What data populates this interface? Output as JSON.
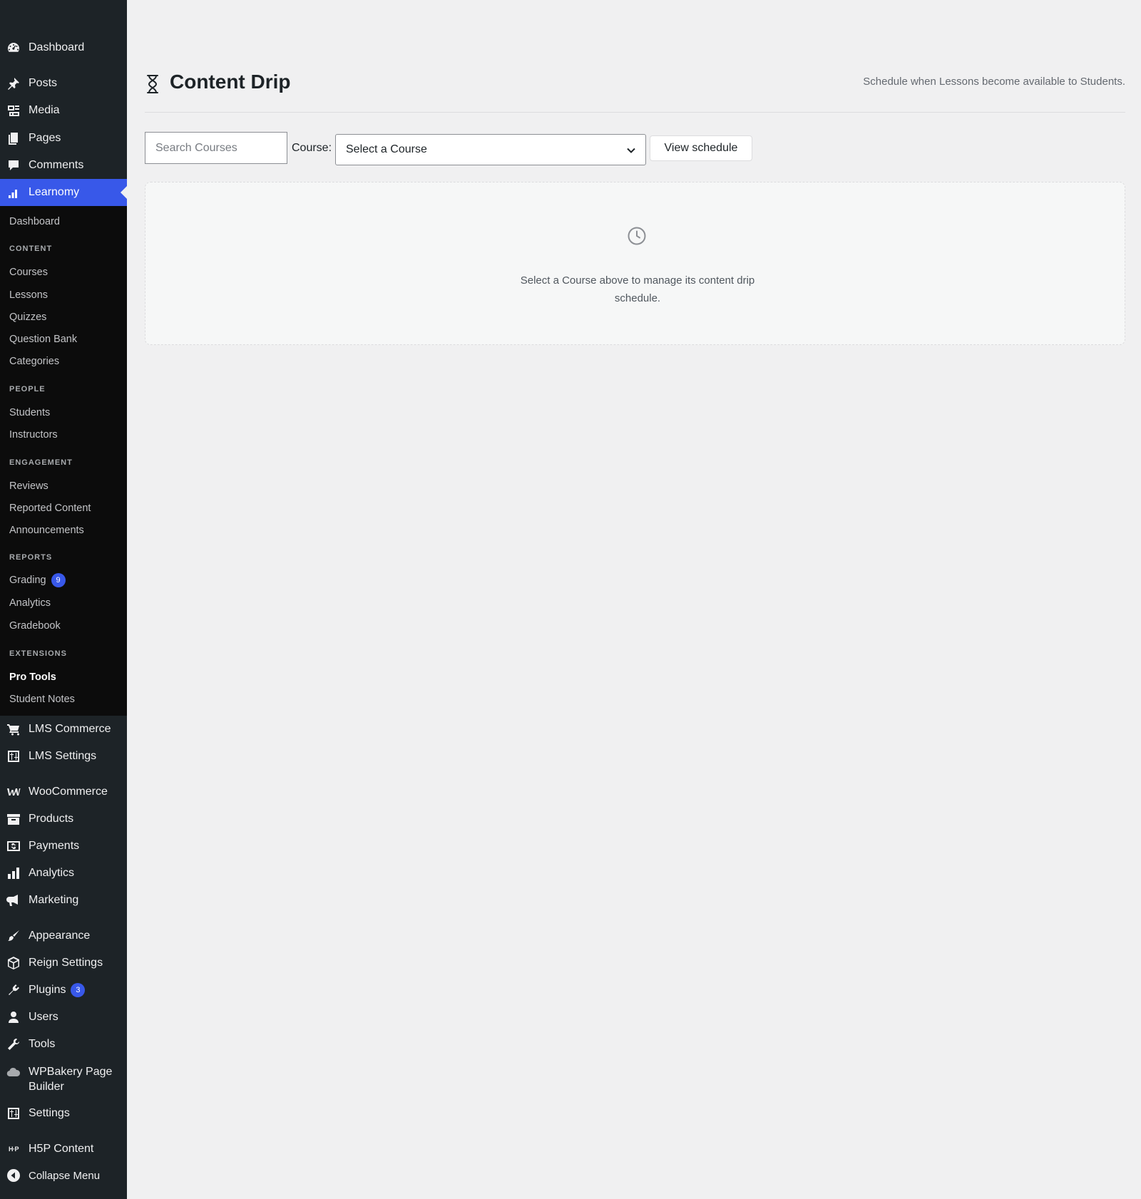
{
  "sidebar": {
    "top_items": [
      {
        "label": "Dashboard",
        "icon": "dashboard-icon"
      },
      {
        "label": "Posts",
        "icon": "pin-icon"
      },
      {
        "label": "Media",
        "icon": "media-icon"
      },
      {
        "label": "Pages",
        "icon": "pages-icon"
      },
      {
        "label": "Comments",
        "icon": "comment-icon"
      },
      {
        "label": "Learnomy",
        "icon": "chart-icon",
        "active": true
      }
    ],
    "submenu": {
      "dashboard": "Dashboard",
      "content_heading": "CONTENT",
      "courses": "Courses",
      "lessons": "Lessons",
      "quizzes": "Quizzes",
      "question_bank": "Question Bank",
      "categories": "Categories",
      "people_heading": "PEOPLE",
      "students": "Students",
      "instructors": "Instructors",
      "engagement_heading": "ENGAGEMENT",
      "reviews": "Reviews",
      "reported_content": "Reported Content",
      "announcements": "Announcements",
      "reports_heading": "REPORTS",
      "grading": "Grading",
      "grading_badge": "9",
      "analytics": "Analytics",
      "gradebook": "Gradebook",
      "extensions_heading": "EXTENSIONS",
      "pro_tools": "Pro Tools",
      "student_notes": "Student Notes"
    },
    "bottom_items": {
      "lms_commerce": "LMS Commerce",
      "lms_settings": "LMS Settings",
      "woocommerce": "WooCommerce",
      "products": "Products",
      "payments": "Payments",
      "analytics": "Analytics",
      "marketing": "Marketing",
      "appearance": "Appearance",
      "reign_settings": "Reign Settings",
      "plugins": "Plugins",
      "plugins_badge": "3",
      "users": "Users",
      "tools": "Tools",
      "wpbakery_line1": "WPBakery Page",
      "wpbakery_line2": "Builder",
      "settings": "Settings",
      "h5p_content": "H5P Content",
      "collapse_menu": "Collapse Menu"
    }
  },
  "main": {
    "title": "Content Drip",
    "description": "Schedule when Lessons become available to Students.",
    "search_placeholder": "Search Courses",
    "course_label": "Course:",
    "course_select_value": "Select a Course",
    "view_button": "View schedule",
    "empty_text": "Select a Course above to manage its content drip schedule."
  },
  "colors": {
    "sidebar_bg": "#1d2327",
    "submenu_bg": "#0c0c0c",
    "accent": "#3858e9",
    "page_bg": "#f0f0f1"
  }
}
